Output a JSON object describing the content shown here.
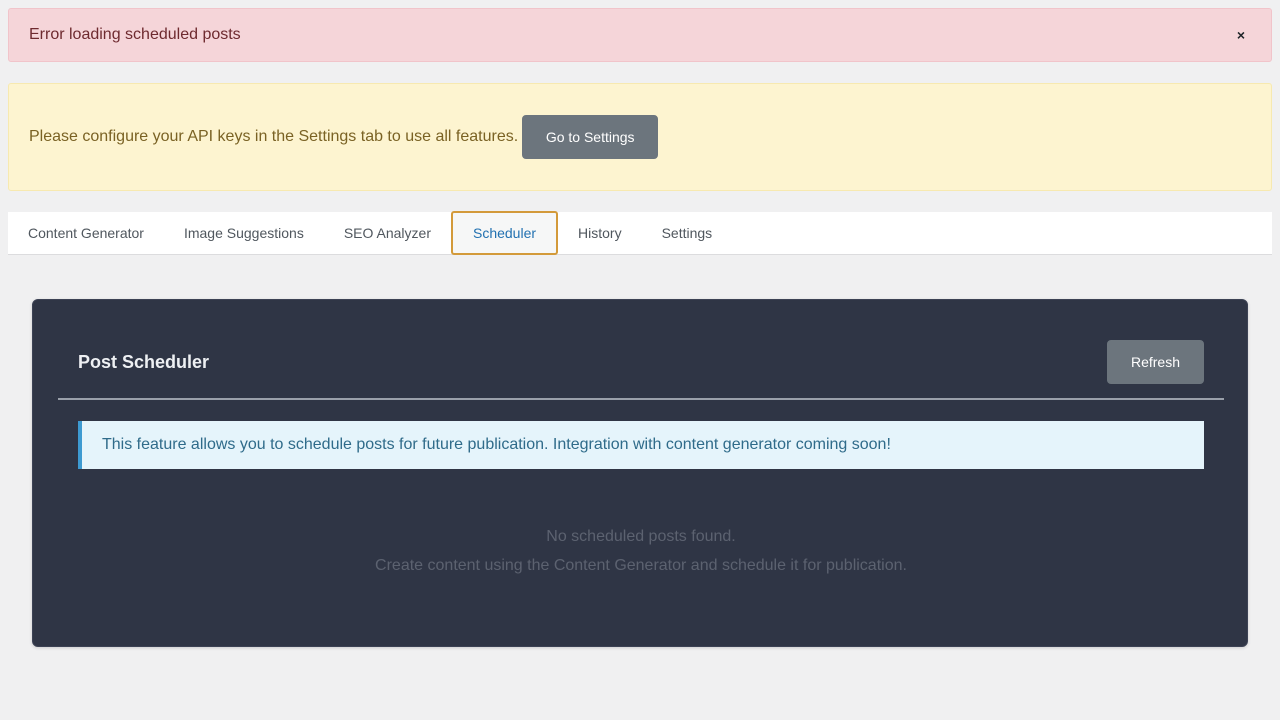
{
  "error_notice": {
    "message": "Error loading scheduled posts",
    "close_label": "×"
  },
  "warning_notice": {
    "message": "Please configure your API keys in the Settings tab to use all features.",
    "button_label": "Go to Settings"
  },
  "tabs": [
    {
      "label": "Content Generator",
      "active": false
    },
    {
      "label": "Image Suggestions",
      "active": false
    },
    {
      "label": "SEO Analyzer",
      "active": false
    },
    {
      "label": "Scheduler",
      "active": true
    },
    {
      "label": "History",
      "active": false
    },
    {
      "label": "Settings",
      "active": false
    }
  ],
  "scheduler": {
    "title": "Post Scheduler",
    "refresh_label": "Refresh",
    "info": "This feature allows you to schedule posts for future publication. Integration with content generator coming soon!",
    "empty_line1": "No scheduled posts found.",
    "empty_line2": "Create content using the Content Generator and schedule it for publication."
  },
  "colors": {
    "error_bg": "#f5d5d9",
    "warning_bg": "#fdf4d0",
    "card_bg": "#2f3545",
    "active_tab_border": "#d39a3a",
    "info_accent": "#3d9ad1"
  }
}
